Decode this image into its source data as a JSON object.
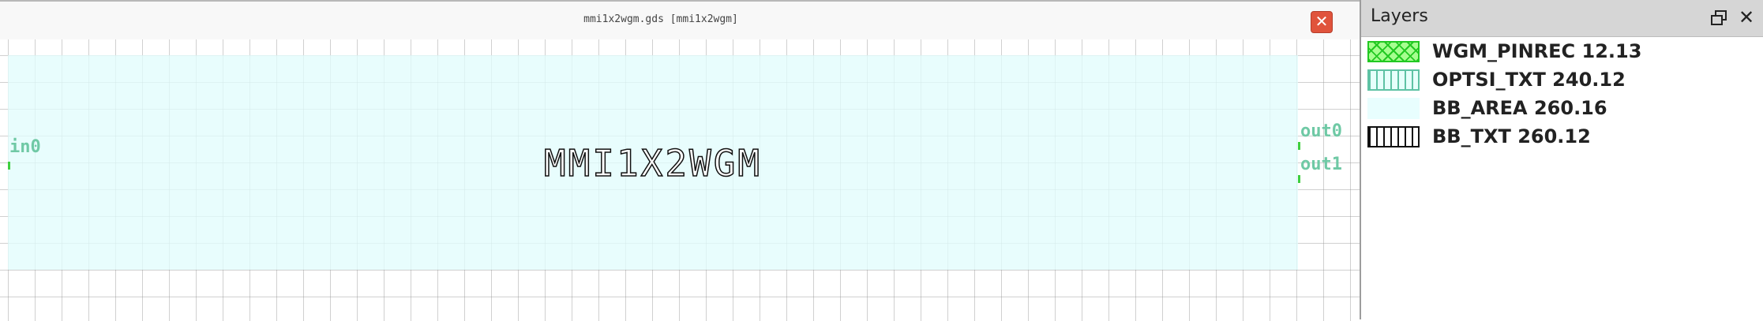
{
  "window": {
    "title": "mmi1x2wgm.gds [mmi1x2wgm]",
    "close_icon": "close-icon",
    "close_glyph": "✕",
    "close_color": "#e0533c"
  },
  "layout": {
    "device_label": "MMI1X2WGM",
    "bb_area_color": "#e1fdfd",
    "pins": [
      {
        "label": "in0",
        "color": "#6fc9a5"
      },
      {
        "label": "out0",
        "color": "#6fc9a5"
      },
      {
        "label": "out1",
        "color": "#6fc9a5"
      }
    ],
    "pin_marker_color": "#3fcf3f"
  },
  "layers_panel": {
    "title": "Layers",
    "float_icon": "float-window-icon",
    "close_icon": "close-icon",
    "close_glyph": "✕",
    "layers": [
      {
        "name": "WGM_PINREC 12.13",
        "fill": "#a6ff8f",
        "pattern": "cross-hatch",
        "outline": "#22c922"
      },
      {
        "name": "OPTSI_TXT 240.12",
        "fill": "#e6fffb",
        "pattern": "vertical-lines",
        "outline": "#5ec2a4"
      },
      {
        "name": "BB_AREA 260.16",
        "fill": "#e8fefe",
        "pattern": "solid",
        "outline": ""
      },
      {
        "name": "BB_TXT 260.12",
        "fill": "#ffffff",
        "pattern": "vertical-lines",
        "outline": "#111111"
      }
    ]
  }
}
